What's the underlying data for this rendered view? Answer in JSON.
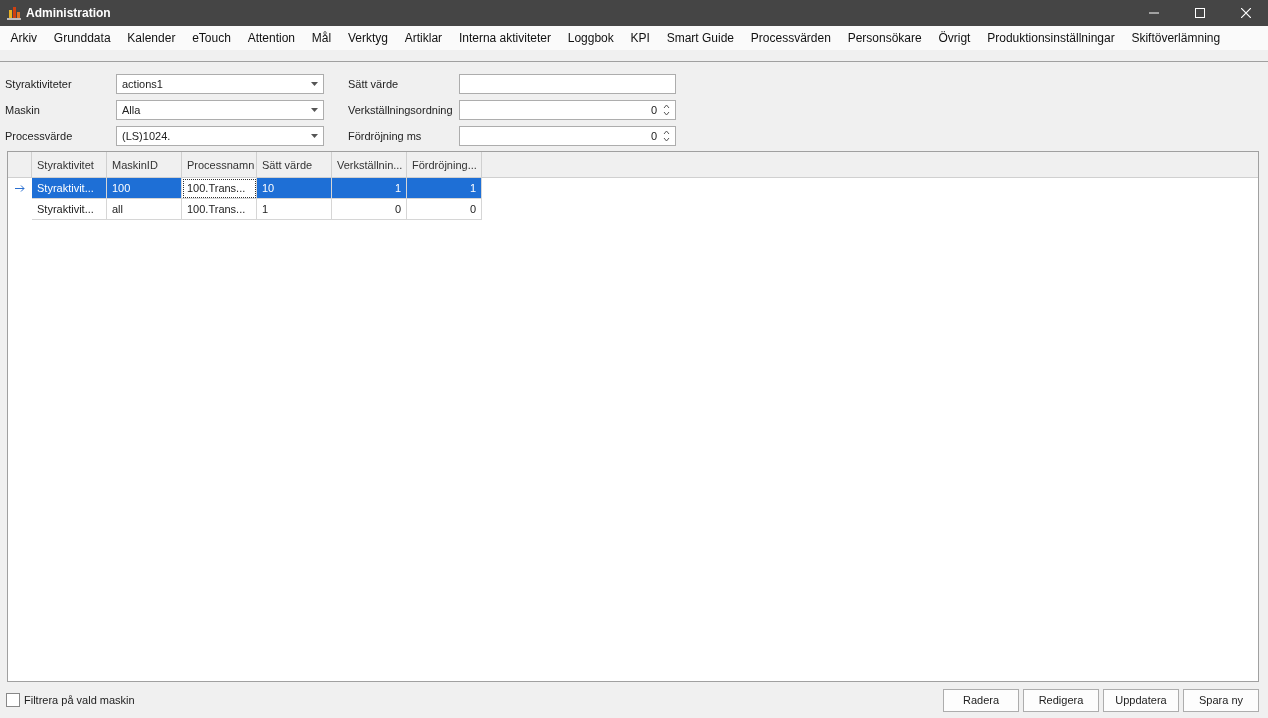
{
  "window": {
    "title": "Administration"
  },
  "menu": [
    {
      "label": "Arkiv"
    },
    {
      "label": "Grunddata"
    },
    {
      "label": "Kalender"
    },
    {
      "label": "eTouch"
    },
    {
      "label": "Attention"
    },
    {
      "label": "Mål"
    },
    {
      "label": "Verktyg"
    },
    {
      "label": "Artiklar"
    },
    {
      "label": "Interna aktiviteter"
    },
    {
      "label": "Loggbok"
    },
    {
      "label": "KPI"
    },
    {
      "label": "Smart Guide"
    },
    {
      "label": "Processvärden"
    },
    {
      "label": "Personsökare"
    },
    {
      "label": "Övrigt"
    },
    {
      "label": "Produktionsinställningar"
    },
    {
      "label": "Skiftöverlämning"
    }
  ],
  "form_left": [
    {
      "label": "Styraktiviteter",
      "kind": "combo",
      "value": "actions1"
    },
    {
      "label": "Maskin",
      "kind": "combo",
      "value": "Alla"
    },
    {
      "label": "Processvärde",
      "kind": "combo",
      "value": "(LS)1024."
    }
  ],
  "form_right": [
    {
      "label": "Sätt värde",
      "kind": "text"
    },
    {
      "label": "Verkställningsordning",
      "kind": "spin",
      "value": "0"
    },
    {
      "label": "Fördröjning ms",
      "kind": "spin",
      "value": "0"
    }
  ],
  "table": {
    "columns": [
      {
        "label": "Styraktivitet",
        "kind": "text"
      },
      {
        "label": "MaskinID",
        "kind": "text"
      },
      {
        "label": "Processnamn",
        "kind": "text"
      },
      {
        "label": "Sätt värde",
        "kind": "text"
      },
      {
        "label": "Verkställnin...",
        "kind": "number"
      },
      {
        "label": "Fördröjning...",
        "kind": "number"
      }
    ],
    "rows": [
      {
        "selected": true,
        "cells": [
          {
            "text": "Styraktivit...",
            "focused": false
          },
          {
            "text": "100",
            "focused": false
          },
          {
            "text": "100.Trans...",
            "focused": true
          },
          {
            "text": "10",
            "focused": false
          },
          {
            "text": "1",
            "focused": false
          },
          {
            "text": "1",
            "focused": false
          }
        ]
      },
      {
        "selected": false,
        "cells": [
          {
            "text": "Styraktivit...",
            "focused": false
          },
          {
            "text": "all",
            "focused": false
          },
          {
            "text": "100.Trans...",
            "focused": false
          },
          {
            "text": "1",
            "focused": false
          },
          {
            "text": "0",
            "focused": false
          },
          {
            "text": "0",
            "focused": false
          }
        ]
      }
    ]
  },
  "filter": {
    "label": "Filtrera på vald maskin",
    "checked": false
  },
  "buttons": [
    {
      "label": "Radera"
    },
    {
      "label": "Redigera"
    },
    {
      "label": "Uppdatera"
    },
    {
      "label": "Spara ny"
    }
  ]
}
